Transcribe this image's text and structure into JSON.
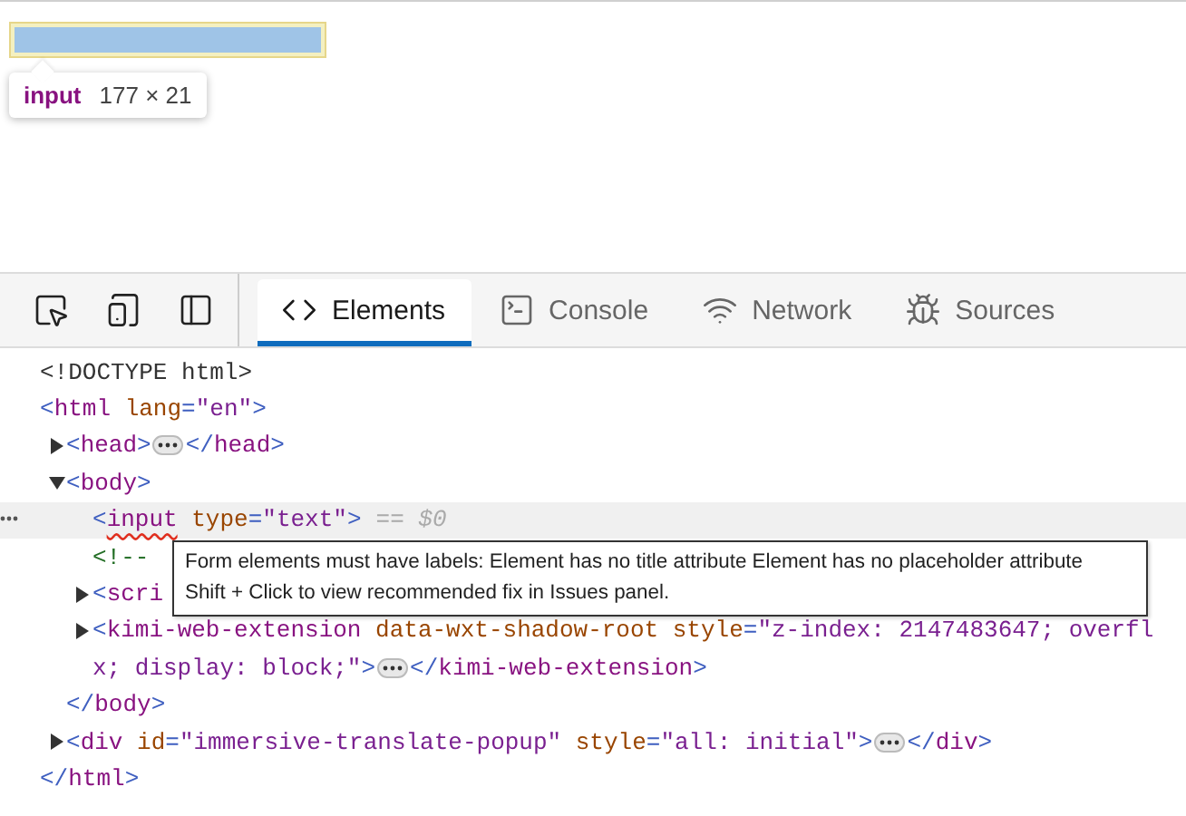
{
  "page": {
    "highlight_tooltip": {
      "tag": "input",
      "size": "177 × 21"
    }
  },
  "toolbar": {
    "tools": [
      {
        "kind": "inspect"
      },
      {
        "kind": "device"
      },
      {
        "kind": "dock"
      }
    ],
    "tabs": [
      {
        "label": "Elements",
        "selected": true
      },
      {
        "label": "Console",
        "selected": false
      },
      {
        "label": "Network",
        "selected": false
      },
      {
        "label": "Sources",
        "selected": false
      }
    ]
  },
  "tree": [
    {
      "open": [
        {
          "kind": "doctype",
          "text": "<!DOCTYPE html>"
        }
      ],
      "selected": false,
      "issue": false
    },
    {
      "open": [
        {
          "kind": "punct",
          "text": "<"
        },
        {
          "kind": "tag",
          "text": "html"
        },
        {
          "kind": "attr",
          "text": " lang"
        },
        {
          "kind": "punct",
          "text": "="
        },
        {
          "kind": "value",
          "text": "\"en\""
        },
        {
          "kind": "punct",
          "text": ">"
        }
      ],
      "selected": false,
      "issue": false,
      "close": [
        {
          "kind": "punct",
          "text": "</"
        },
        {
          "kind": "tag",
          "text": "html"
        },
        {
          "kind": "punct",
          "text": ">"
        }
      ],
      "children": [
        {
          "open": [
            {
              "kind": "punct",
              "text": "<"
            },
            {
              "kind": "tag",
              "text": "head"
            },
            {
              "kind": "punct",
              "text": ">"
            }
          ],
          "expanded": false,
          "selected": false,
          "issue": false,
          "close": [
            {
              "kind": "punct",
              "text": "</"
            },
            {
              "kind": "tag",
              "text": "head"
            },
            {
              "kind": "punct",
              "text": ">"
            }
          ]
        },
        {
          "open": [
            {
              "kind": "punct",
              "text": "<"
            },
            {
              "kind": "tag",
              "text": "body"
            },
            {
              "kind": "punct",
              "text": ">"
            }
          ],
          "expanded": true,
          "selected": false,
          "issue": false,
          "close": [
            {
              "kind": "punct",
              "text": "</"
            },
            {
              "kind": "tag",
              "text": "body"
            },
            {
              "kind": "punct",
              "text": ">"
            }
          ],
          "children": [
            {
              "open": [
                {
                  "kind": "punct",
                  "text": "<"
                },
                {
                  "kind": "tag",
                  "text": "input"
                },
                {
                  "kind": "attr",
                  "text": " type"
                },
                {
                  "kind": "punct",
                  "text": "="
                },
                {
                  "kind": "value",
                  "text": "\"text\""
                },
                {
                  "kind": "punct",
                  "text": ">"
                }
              ],
              "selected": true,
              "issue": true,
              "console_ref": "== $0"
            },
            {
              "open": [
                {
                  "kind": "comment",
                  "text": "<!--"
                }
              ],
              "selected": false,
              "issue": false
            },
            {
              "open": [
                {
                  "kind": "punct",
                  "text": "<"
                },
                {
                  "kind": "tag",
                  "text": "scri"
                }
              ],
              "expanded": false,
              "selected": false,
              "issue": false
            },
            {
              "open": [
                {
                  "kind": "punct",
                  "text": "<"
                },
                {
                  "kind": "tag",
                  "text": "kimi-web-extension"
                },
                {
                  "kind": "attr",
                  "text": " data-wxt-shadow-root"
                },
                {
                  "kind": "attr",
                  "text": " style"
                },
                {
                  "kind": "punct",
                  "text": "="
                },
                {
                  "kind": "value",
                  "text": "\"z-index: 2147483647; overfl"
                }
              ],
              "open_wrap": [
                {
                  "kind": "value",
                  "text": "x; display: block;\""
                },
                {
                  "kind": "punct",
                  "text": ">"
                }
              ],
              "expanded": false,
              "selected": false,
              "issue": false,
              "close": [
                {
                  "kind": "punct",
                  "text": "</"
                },
                {
                  "kind": "tag",
                  "text": "kimi-web-extension"
                },
                {
                  "kind": "punct",
                  "text": ">"
                }
              ]
            }
          ]
        },
        {
          "open": [
            {
              "kind": "punct",
              "text": "<"
            },
            {
              "kind": "tag",
              "text": "div"
            },
            {
              "kind": "attr",
              "text": " id"
            },
            {
              "kind": "punct",
              "text": "="
            },
            {
              "kind": "value",
              "text": "\"immersive-translate-popup\""
            },
            {
              "kind": "attr",
              "text": " style"
            },
            {
              "kind": "punct",
              "text": "="
            },
            {
              "kind": "value",
              "text": "\"all: initial\""
            },
            {
              "kind": "punct",
              "text": ">"
            }
          ],
          "expanded": false,
          "selected": false,
          "issue": false,
          "close": [
            {
              "kind": "punct",
              "text": "</"
            },
            {
              "kind": "tag",
              "text": "div"
            },
            {
              "kind": "punct",
              "text": ">"
            }
          ]
        }
      ]
    }
  ],
  "issue_tooltip": {
    "lines": [
      "Form elements must have labels: Element has no title attribute Element has no placeholder attribute",
      "Shift + Click to view recommended fix in Issues panel."
    ]
  }
}
